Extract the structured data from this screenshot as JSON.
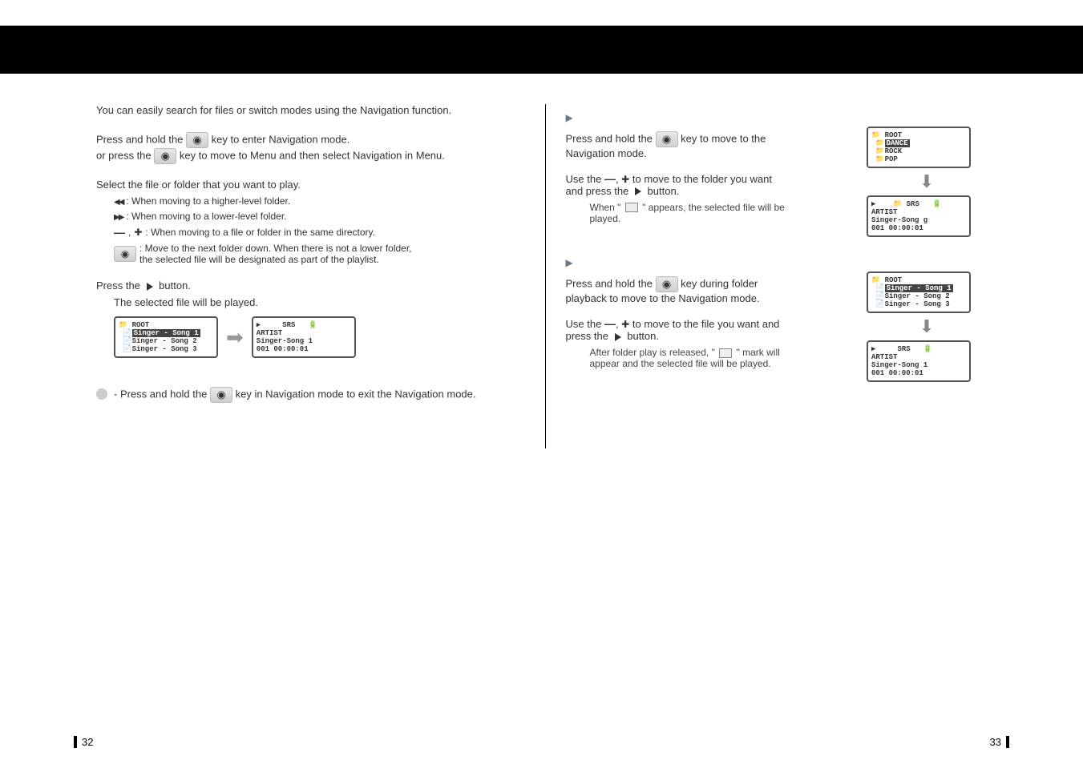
{
  "pages": {
    "left": "32",
    "right": "33"
  },
  "left": {
    "intro": "You can easily search for files or switch modes using the Navigation function.",
    "step1a": "Press and hold the",
    "step1b": "key to enter Navigation mode.",
    "step1c": "or press the",
    "step1d": "key to move to Menu and then select Navigation in Menu.",
    "step2": "Select the file or folder that you want to play.",
    "nav_rw": ": When moving to a higher-level folder.",
    "nav_ff": ": When moving to a lower-level folder.",
    "nav_pm": ": When moving to a file or folder in the same directory.",
    "nav_center1": ": Move to the next folder down. When there is not a lower folder,",
    "nav_center2": "the selected file will be designated as part of the playlist.",
    "step3a": "Press the",
    "step3b": "button.",
    "step3_sub": "The selected file will be played.",
    "note": "- Press and hold the",
    "note2": "key in Navigation mode to exit the Navigation mode.",
    "screen1": {
      "root": "ROOT",
      "row1": "Singer - Song 1",
      "row2": "Singer - Song 2",
      "row3": "Singer - Song 3"
    },
    "screen2": {
      "top": "SRS",
      "artist": "ARTIST",
      "song": "Singer-Song 1",
      "time": "001   00:00:01"
    }
  },
  "right": {
    "sec1": {
      "l1a": "Press and hold the",
      "l1b": "key to move to the",
      "l1c": "Navigation mode.",
      "l2a": "Use the",
      "l2b": "to move to the folder you want",
      "l2c": "and press the",
      "l2d": "button.",
      "l2e": "When \"",
      "l2f": "\" appears, the selected file will be",
      "l2g": "played.",
      "screenA": {
        "root": "ROOT",
        "r1": "DANCE",
        "r2": "ROCK",
        "r3": "POP"
      },
      "screenB": {
        "top": "SRS",
        "artist": "ARTIST",
        "song": "Singer-Song g",
        "time": "001   00:00:01"
      }
    },
    "sec2": {
      "l1a": "Press and hold the",
      "l1b": "key during folder",
      "l1c": "playback to move to the Navigation mode.",
      "l2a": "Use the",
      "l2b": "to move to the file you want and",
      "l2c": "press the",
      "l2d": "button.",
      "l2e": "After folder play is released, \"",
      "l2f": "\" mark will",
      "l2g": "appear and the selected file will be played.",
      "screenA": {
        "root": "ROOT",
        "r1": "Singer - Song 1",
        "r2": "Singer - Song 2",
        "r3": "Singer - Song 3"
      },
      "screenB": {
        "top": "SRS",
        "artist": "ARTIST",
        "song": "Singer-Song 1",
        "time": "001   00:00:01"
      }
    }
  }
}
